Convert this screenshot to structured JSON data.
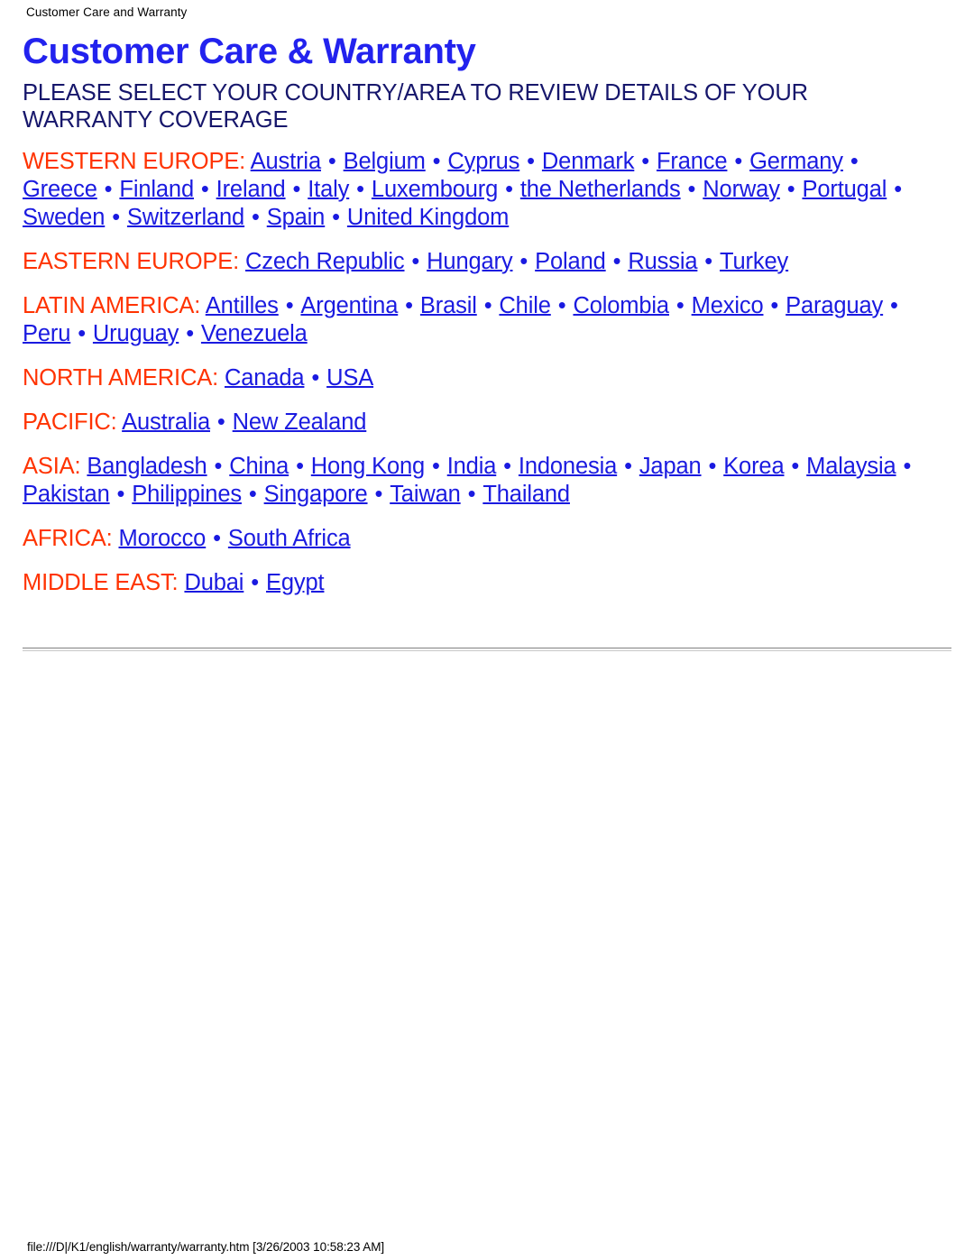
{
  "page": {
    "running_head": "Customer Care and Warranty",
    "footer_path": "file:///D|/K1/english/warranty/warranty.htm [3/26/2003 10:58:23 AM]"
  },
  "colors": {
    "title_blue": "#2222EE",
    "subtitle_navy": "#16166B",
    "region_orange": "#FF3300",
    "link_blue": "#1A1AE0",
    "rule_gray": "#808080"
  },
  "main": {
    "title": "Customer Care & Warranty",
    "subtitle": "PLEASE SELECT YOUR COUNTRY/AREA TO REVIEW DETAILS OF YOUR WARRANTY COVERAGE",
    "separator": "•",
    "regions": [
      {
        "label": "WESTERN EUROPE",
        "countries": [
          "Austria",
          "Belgium",
          "Cyprus",
          "Denmark",
          "France",
          "Germany",
          "Greece",
          "Finland",
          "Ireland",
          "Italy",
          "Luxembourg",
          "the Netherlands",
          "Norway",
          "Portugal",
          "Sweden",
          "Switzerland",
          "Spain",
          "United Kingdom"
        ]
      },
      {
        "label": "EASTERN EUROPE",
        "countries": [
          "Czech Republic",
          "Hungary",
          "Poland",
          "Russia",
          "Turkey"
        ]
      },
      {
        "label": "LATIN AMERICA",
        "countries": [
          "Antilles",
          "Argentina",
          "Brasil",
          "Chile",
          "Colombia",
          "Mexico",
          "Paraguay",
          "Peru",
          "Uruguay",
          "Venezuela"
        ]
      },
      {
        "label": "NORTH AMERICA",
        "countries": [
          "Canada",
          "USA"
        ]
      },
      {
        "label": "PACIFIC",
        "countries": [
          "Australia",
          "New Zealand"
        ]
      },
      {
        "label": "ASIA",
        "countries": [
          "Bangladesh",
          "China",
          "Hong Kong",
          "India",
          "Indonesia",
          "Japan",
          "Korea",
          "Malaysia",
          "Pakistan",
          "Philippines",
          "Singapore",
          "Taiwan",
          "Thailand"
        ]
      },
      {
        "label": "AFRICA",
        "countries": [
          "Morocco",
          "South Africa"
        ]
      },
      {
        "label": "MIDDLE EAST",
        "countries": [
          "Dubai",
          "Egypt"
        ]
      }
    ]
  }
}
